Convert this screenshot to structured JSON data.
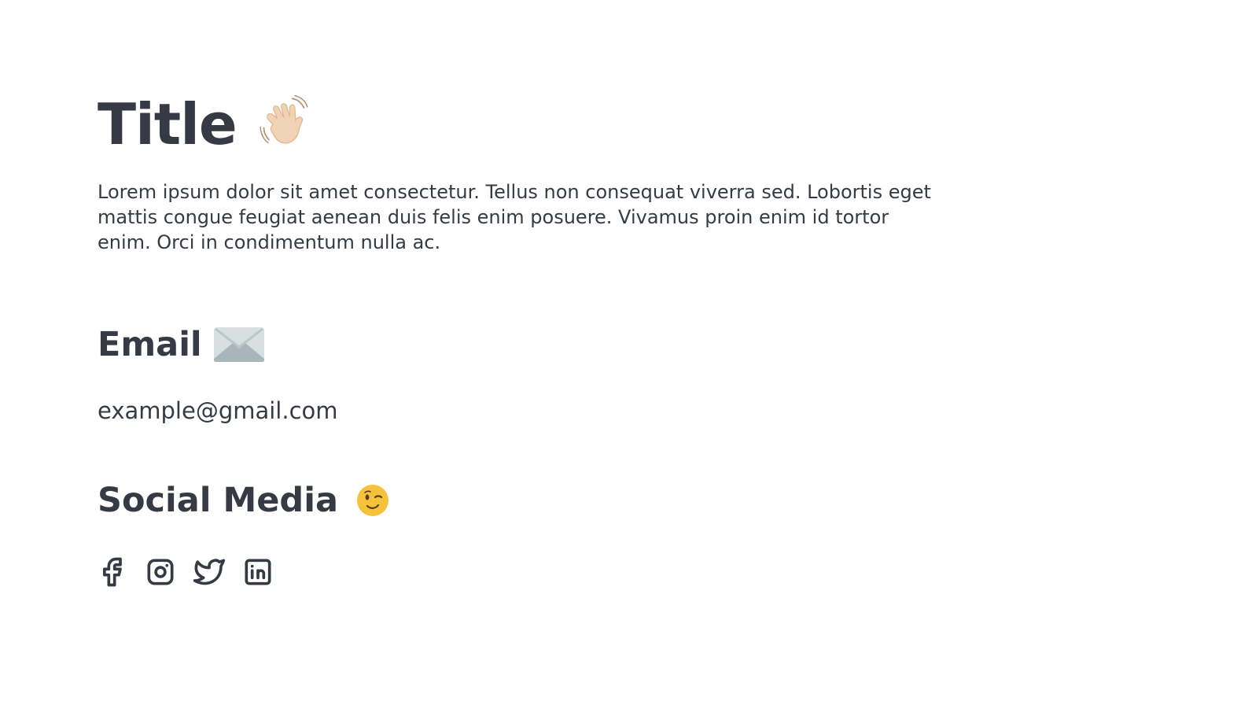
{
  "header": {
    "title": "Title",
    "title_icon": "waving-hand-icon"
  },
  "intro": {
    "text": "Lorem ipsum dolor sit amet consectetur. Tellus non consequat viverra sed. Lobortis eget mattis congue feugiat aenean duis felis enim posuere. Vivamus proin enim id tortor enim. Orci in condimentum nulla ac."
  },
  "email": {
    "heading": "Email",
    "heading_icon": "envelope-icon",
    "address": "example@gmail.com"
  },
  "social": {
    "heading": "Social Media",
    "heading_icon": "winking-face-icon",
    "links": [
      {
        "name": "facebook",
        "icon": "facebook-icon"
      },
      {
        "name": "instagram",
        "icon": "instagram-icon"
      },
      {
        "name": "twitter",
        "icon": "twitter-icon"
      },
      {
        "name": "linkedin",
        "icon": "linkedin-icon"
      }
    ]
  },
  "colors": {
    "text": "#353a45",
    "background": "#ffffff",
    "wink_face": "#f5c33b",
    "hand_skin": "#f0d3b4",
    "envelope": "#a9b7bd"
  }
}
